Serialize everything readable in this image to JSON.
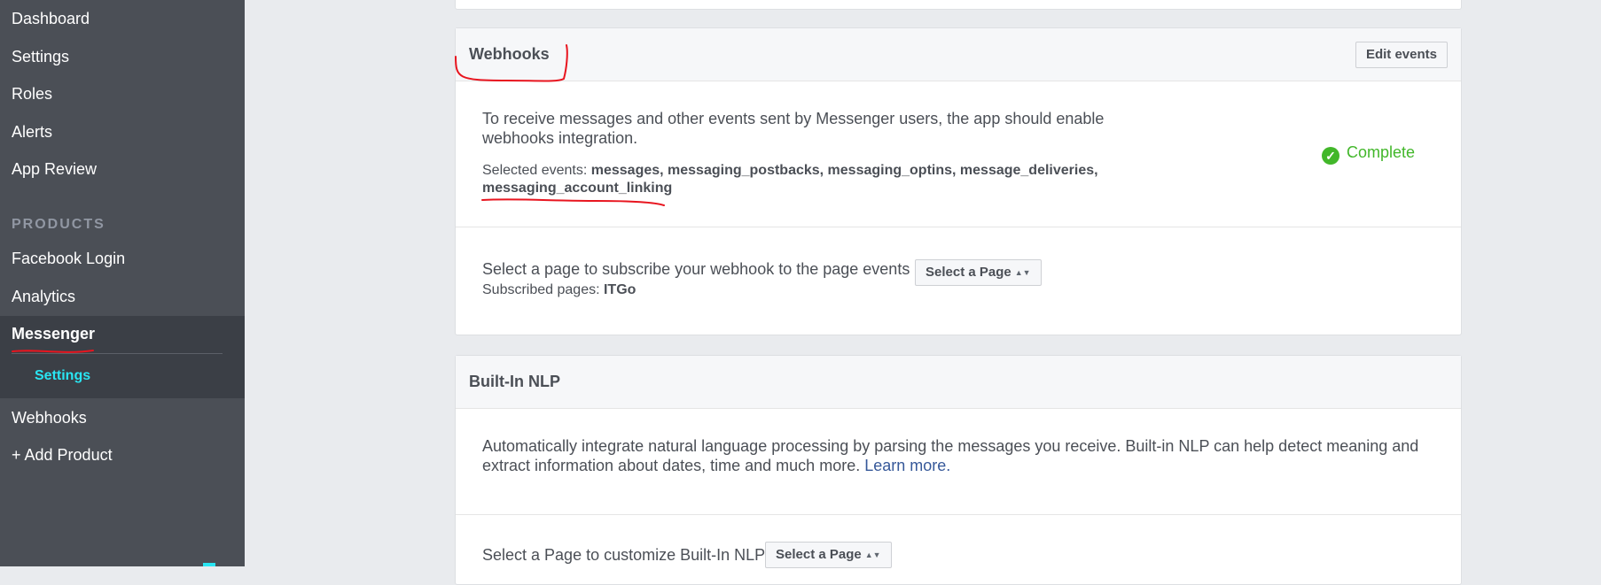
{
  "sidebar": {
    "items": [
      {
        "label": "Dashboard"
      },
      {
        "label": "Settings"
      },
      {
        "label": "Roles"
      },
      {
        "label": "Alerts"
      },
      {
        "label": "App Review"
      }
    ],
    "products_label": "PRODUCTS",
    "products": [
      {
        "label": "Facebook Login"
      },
      {
        "label": "Analytics"
      },
      {
        "label": "Messenger"
      }
    ],
    "messenger_sub": {
      "label": "Settings"
    },
    "after": [
      {
        "label": "Webhooks"
      },
      {
        "label": "+ Add Product"
      }
    ]
  },
  "webhooks": {
    "title": "Webhooks",
    "edit_button": "Edit events",
    "description": "To receive messages and other events sent by Messenger users, the app should enable webhooks integration.",
    "selected_label": "Selected events:",
    "selected_events": "messages, messaging_postbacks, messaging_optins, message_deliveries,",
    "selected_events_2": "messaging_account_linking",
    "status": "Complete",
    "subscribe_text": "Select a page to subscribe your webhook to the page events",
    "select_page_button": "Select a Page",
    "subscribed_label": "Subscribed pages:",
    "subscribed_value": "ITGo"
  },
  "nlp": {
    "title": "Built-In NLP",
    "description": "Automatically integrate natural language processing by parsing the messages you receive. Built-in NLP can help detect meaning and extract information about dates, time and much more.",
    "learn_more": "Learn more.",
    "customize_text": "Select a Page to customize Built-In NLP",
    "select_page_button": "Select a Page"
  },
  "colors": {
    "sidebar_bg": "#4b4f56",
    "active_sub": "#29e5f2",
    "status_green": "#42b72a",
    "annotation_red": "#e8151f",
    "link": "#365899"
  }
}
